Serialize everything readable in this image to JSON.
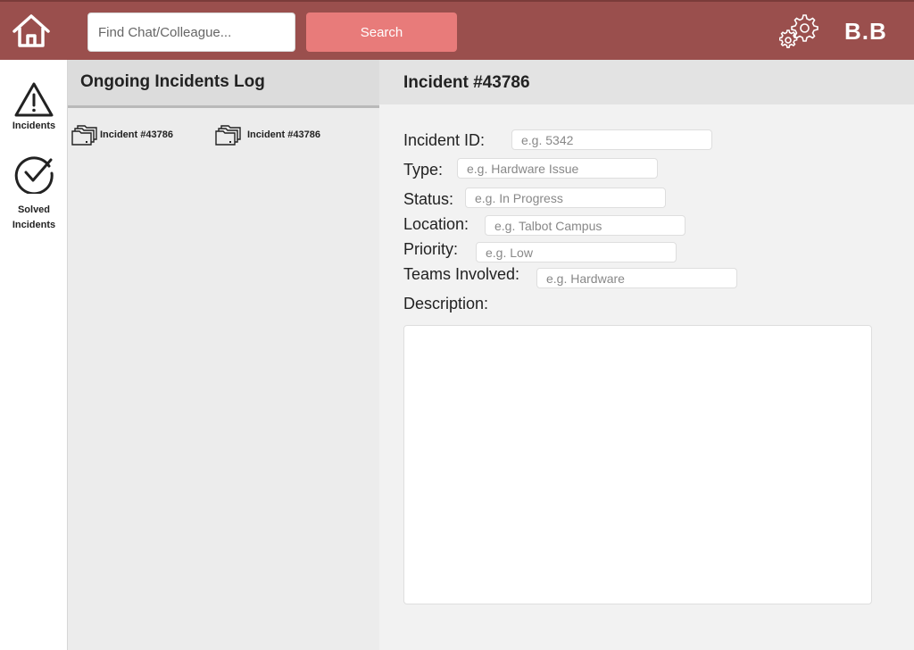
{
  "topbar": {
    "search_placeholder": "Find Chat/Colleague...",
    "search_button": "Search",
    "user_initials": "B.B",
    "background_color": "#9a4f4d",
    "search_button_color": "#e87b7a",
    "home_icon": "home-icon",
    "settings_icon": "gear-icon"
  },
  "sidebar": {
    "items": [
      {
        "label": "Incidents",
        "icon": "warning-icon"
      },
      {
        "label": "Solved Incidents",
        "icon": "check-circle-icon"
      }
    ]
  },
  "log": {
    "title": "Ongoing Incidents Log",
    "items": [
      {
        "label": "Incident #43786",
        "icon": "folder-stack-icon"
      },
      {
        "label": "Incident #43786",
        "icon": "folder-stack-icon"
      }
    ]
  },
  "detail": {
    "title": "Incident #43786",
    "fields": {
      "incident_id": {
        "label": "Incident ID:",
        "placeholder": "e.g. 5342"
      },
      "type": {
        "label": "Type:",
        "placeholder": "e.g. Hardware Issue"
      },
      "status": {
        "label": "Status:",
        "placeholder": "e.g. In Progress"
      },
      "location": {
        "label": "Location:",
        "placeholder": "e.g. Talbot Campus"
      },
      "priority": {
        "label": "Priority:",
        "placeholder": "e.g. Low"
      },
      "teams": {
        "label": "Teams Involved:",
        "placeholder": "e.g. Hardware"
      }
    },
    "description_label": "Description:"
  }
}
